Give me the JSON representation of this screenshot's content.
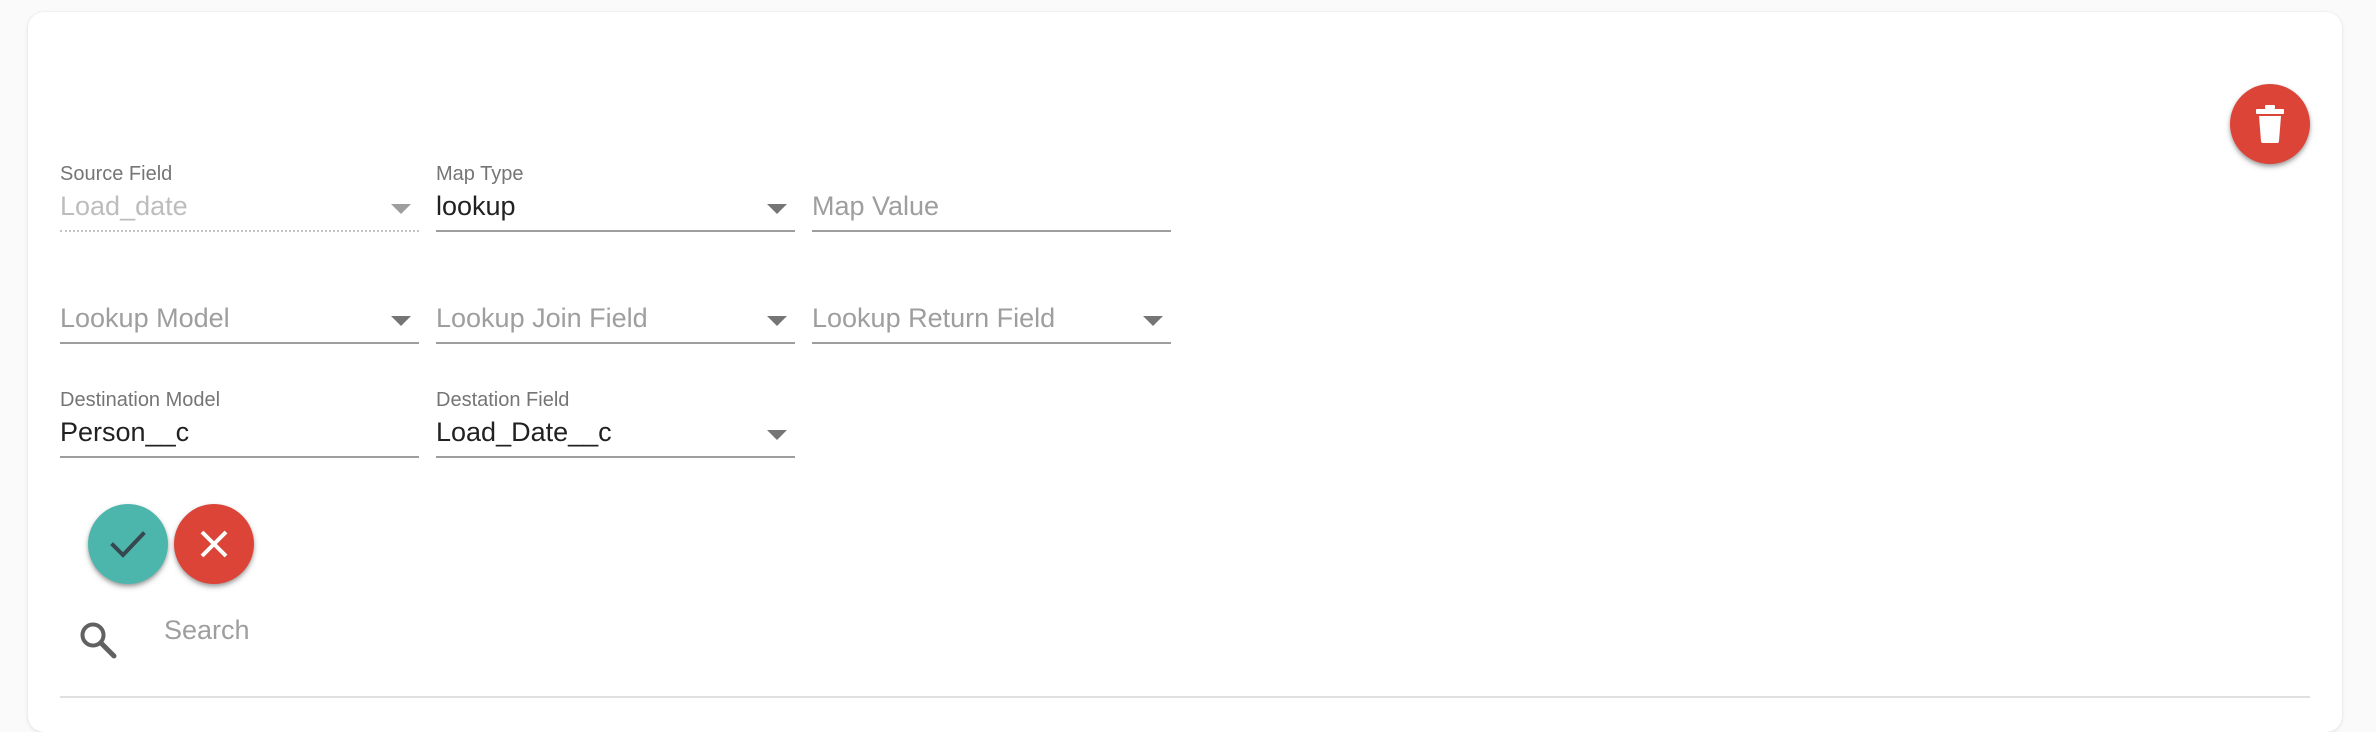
{
  "colors": {
    "danger": "#db4437",
    "confirm": "#4db6ac",
    "underline": "#9e9e9e",
    "label": "#757575"
  },
  "row1": {
    "source_field": {
      "label": "Source Field",
      "value": "Load_date",
      "icon": "arrow-drop-down-icon"
    },
    "map_type": {
      "label": "Map Type",
      "value": "lookup",
      "icon": "arrow-drop-down-icon"
    },
    "map_value": {
      "placeholder": "Map Value"
    }
  },
  "row2": {
    "lookup_model": {
      "placeholder": "Lookup Model",
      "icon": "arrow-drop-down-icon"
    },
    "lookup_join_field": {
      "placeholder": "Lookup Join Field",
      "icon": "arrow-drop-down-icon"
    },
    "lookup_return_field": {
      "placeholder": "Lookup Return Field",
      "icon": "arrow-drop-down-icon"
    }
  },
  "row3": {
    "destination_model": {
      "label": "Destination Model",
      "value": "Person__c"
    },
    "destination_field": {
      "label": "Destation Field",
      "value": "Load_Date__c",
      "icon": "arrow-drop-down-icon"
    }
  },
  "actions": {
    "delete_icon": "trash-icon",
    "confirm_icon": "check-icon",
    "cancel_icon": "close-icon"
  },
  "search": {
    "placeholder": "Search",
    "icon": "search-icon"
  }
}
